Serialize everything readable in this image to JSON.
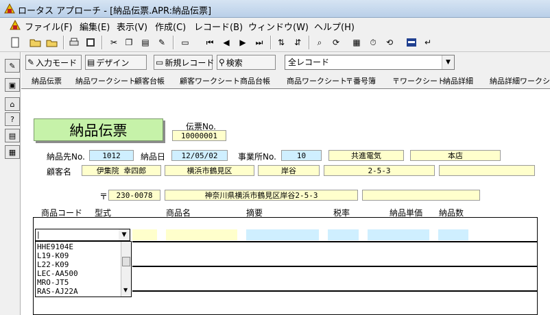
{
  "window": {
    "title": "ロータス アプローチ - [納品伝票.APR:納品伝票]"
  },
  "menu": [
    "ファイル(F)",
    "編集(E)",
    "表示(V)",
    "作成(C)",
    "レコード(B)",
    "ウィンドウ(W)",
    "ヘルプ(H)"
  ],
  "modebar": {
    "input_mode": "入力モード",
    "design": "デザイン",
    "new_record": "新規レコード",
    "search": "検索",
    "view_select": "全レコード"
  },
  "tabs": [
    "納品伝票",
    "納品ワークシート",
    "顧客台帳",
    "顧客ワークシート",
    "商品台帳",
    "商品ワークシート",
    "〒番号簿",
    "〒ワークシート",
    "納品詳細",
    "納品詳細ワークシー"
  ],
  "form": {
    "title": "納品伝票",
    "slip_no_label": "伝票No.",
    "slip_no": "10000001",
    "customer_no_label": "納品先No.",
    "customer_no": "1012",
    "date_label": "納品日",
    "date": "12/05/02",
    "office_no_label": "事業所No.",
    "office_no": "10",
    "company": "共進電気",
    "branch": "本店",
    "customer_name_label": "顧客名",
    "customer_name": "伊集院 幸四郎",
    "city": "横浜市鶴見区",
    "town": "岸谷",
    "block": "2-5-3",
    "postal_mark": "〒",
    "postal_code": "230-0078",
    "full_address": "神奈川県横浜市鶴見区岸谷2-5-3"
  },
  "grid": {
    "headers": [
      "商品コード",
      "型式",
      "商品名",
      "摘要",
      "税率",
      "納品単価",
      "納品数"
    ],
    "combo_value": "|",
    "options": [
      "HHE9104E",
      "L19-K09",
      "L22-K09",
      "LEC-AA500",
      "MRO-JT5",
      "RAS-AJ22A"
    ]
  }
}
